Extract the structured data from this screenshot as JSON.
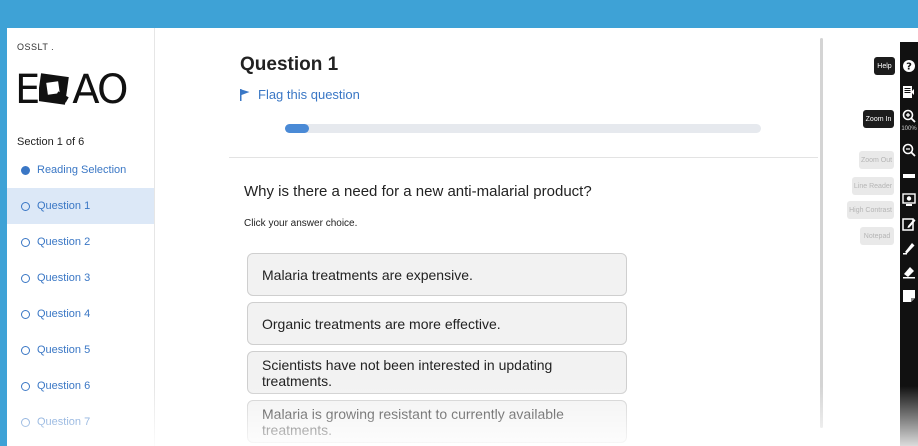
{
  "sidebar": {
    "org": "OSSLT .",
    "logo": {
      "left": "E",
      "mid": "Q",
      "right": "AO"
    },
    "section_label": "Section 1 of 6",
    "items": [
      {
        "label": "Reading Selection",
        "state": "filled"
      },
      {
        "label": "Question 1",
        "state": "active"
      },
      {
        "label": "Question 2",
        "state": "empty"
      },
      {
        "label": "Question 3",
        "state": "empty"
      },
      {
        "label": "Question 4",
        "state": "empty"
      },
      {
        "label": "Question 5",
        "state": "empty"
      },
      {
        "label": "Question 6",
        "state": "empty"
      },
      {
        "label": "Question 7",
        "state": "empty"
      }
    ]
  },
  "main": {
    "title": "Question 1",
    "flag_label": "Flag this question",
    "progress_fraction": 0.05,
    "prompt": "Why is there a need for a new anti-malarial product?",
    "instruction": "Click your answer choice.",
    "choices": [
      "Malaria treatments are expensive.",
      "Organic treatments are more effective.",
      "Scientists have not been interested in updating treatments.",
      "Malaria is growing resistant to currently available treatments."
    ]
  },
  "toolbar": {
    "zoom_level": "100%",
    "tooltips": {
      "help": "Help",
      "zoom_in": "Zoom In",
      "zoom_out": "Zoom Out",
      "line_reader": "Line Reader",
      "high_contrast": "High Contrast",
      "notepad": "Notepad"
    },
    "colors": {
      "bar": "#111111",
      "tooltip_dark": "#1c1c1c",
      "tooltip_light": "#e9e9e9"
    }
  },
  "colors": {
    "frame": "#3ea2d6",
    "accent": "#3a77c5",
    "active_bg": "#dce8f7",
    "progress": "#4a8ad6"
  }
}
